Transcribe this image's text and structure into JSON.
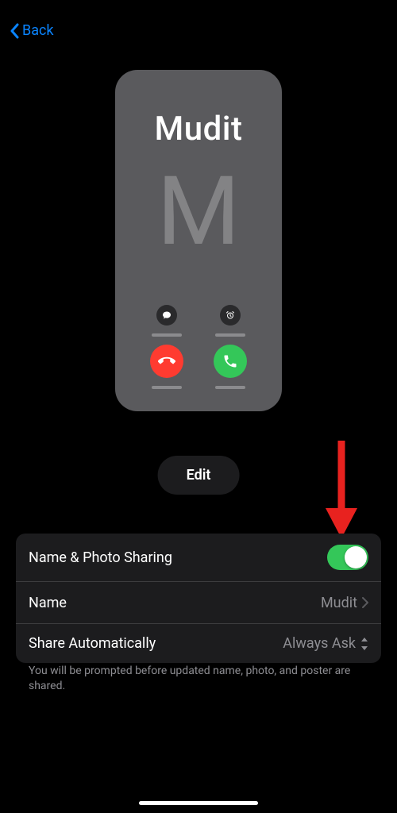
{
  "nav": {
    "back_label": "Back"
  },
  "poster": {
    "name": "Mudit",
    "initial": "M"
  },
  "edit": {
    "label": "Edit"
  },
  "settings": {
    "row1": {
      "label": "Name & Photo Sharing",
      "toggle_on": true
    },
    "row2": {
      "label": "Name",
      "value": "Mudit"
    },
    "row3": {
      "label": "Share Automatically",
      "value": "Always Ask"
    }
  },
  "footer": {
    "text": "You will be prompted before updated name, photo, and poster are shared."
  }
}
